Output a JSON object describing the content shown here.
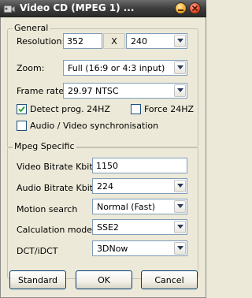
{
  "window": {
    "title": "Video CD (MPEG 1) ...",
    "minimize_icon": "minimize-icon",
    "close_icon": "close-icon"
  },
  "general": {
    "legend": "General",
    "resolution": {
      "label": "Resolution:",
      "width": "352",
      "separator": "X",
      "height": "240"
    },
    "zoom": {
      "label": "Zoom:",
      "value": "Full (16:9 or 4:3 input)"
    },
    "frame_rate": {
      "label": "Frame rate:",
      "value": "29.97 NTSC"
    },
    "detect_prog": {
      "label": "Detect prog. 24HZ",
      "checked": true
    },
    "force_24hz": {
      "label": "Force 24HZ",
      "checked": false
    },
    "av_sync": {
      "label": "Audio / Video synchronisation",
      "checked": false
    }
  },
  "mpeg": {
    "legend": "Mpeg Specific",
    "video_bitrate": {
      "label": "Video Bitrate Kbits",
      "value": "1150"
    },
    "audio_bitrate": {
      "label": "Audio Bitrate Kbits",
      "value": "224"
    },
    "motion_search": {
      "label": "Motion search",
      "value": "Normal (Fast)"
    },
    "calculation_mode": {
      "label": "Calculation mode",
      "value": "SSE2"
    },
    "dct": {
      "label": "DCT/iDCT",
      "value": "3DNow"
    }
  },
  "buttons": {
    "standard": "Standard",
    "ok": "OK",
    "cancel": "Cancel"
  }
}
